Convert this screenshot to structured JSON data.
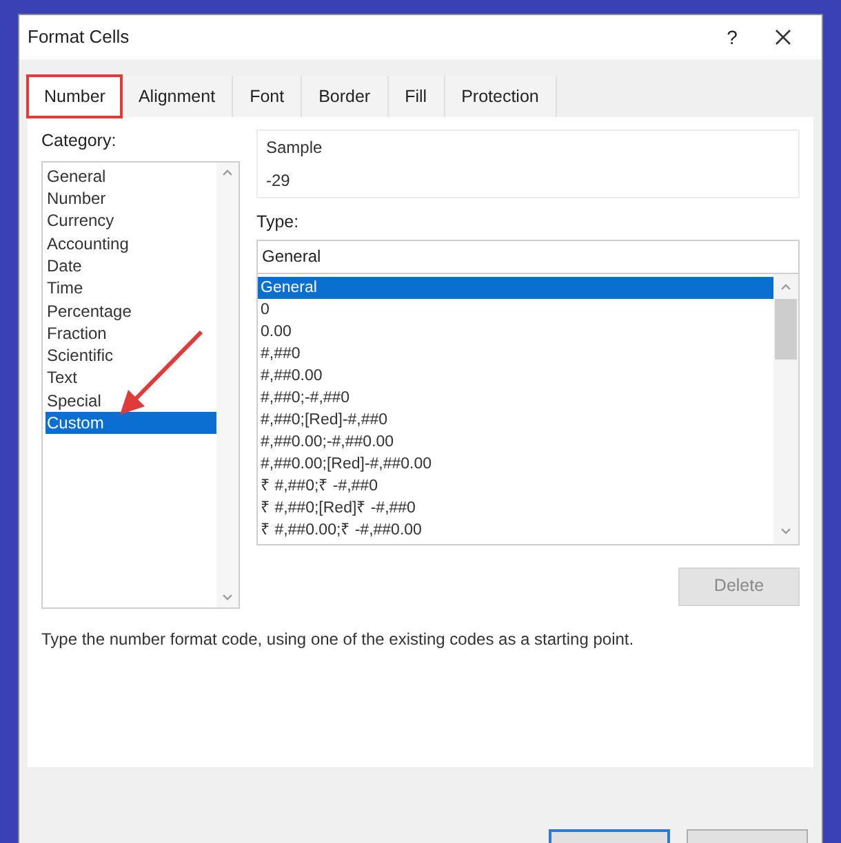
{
  "window": {
    "title": "Format Cells",
    "help": "?"
  },
  "tabs": [
    {
      "label": "Number",
      "selected": true,
      "highlighted": true
    },
    {
      "label": "Alignment",
      "selected": false,
      "highlighted": false
    },
    {
      "label": "Font",
      "selected": false,
      "highlighted": false
    },
    {
      "label": "Border",
      "selected": false,
      "highlighted": false
    },
    {
      "label": "Fill",
      "selected": false,
      "highlighted": false
    },
    {
      "label": "Protection",
      "selected": false,
      "highlighted": false
    }
  ],
  "category": {
    "label": "Category:",
    "items": [
      {
        "label": "General",
        "selected": false
      },
      {
        "label": "Number",
        "selected": false
      },
      {
        "label": "Currency",
        "selected": false
      },
      {
        "label": "Accounting",
        "selected": false
      },
      {
        "label": "Date",
        "selected": false
      },
      {
        "label": "Time",
        "selected": false
      },
      {
        "label": "Percentage",
        "selected": false
      },
      {
        "label": "Fraction",
        "selected": false
      },
      {
        "label": "Scientific",
        "selected": false
      },
      {
        "label": "Text",
        "selected": false
      },
      {
        "label": "Special",
        "selected": false
      },
      {
        "label": "Custom",
        "selected": true,
        "arrow": true
      }
    ]
  },
  "sample": {
    "label": "Sample",
    "value": "-29"
  },
  "type": {
    "label": "Type:",
    "value": "General",
    "items": [
      {
        "label": "General",
        "selected": true
      },
      {
        "label": "0",
        "selected": false
      },
      {
        "label": "0.00",
        "selected": false
      },
      {
        "label": "#,##0",
        "selected": false
      },
      {
        "label": "#,##0.00",
        "selected": false
      },
      {
        "label": "#,##0;-#,##0",
        "selected": false
      },
      {
        "label": "#,##0;[Red]-#,##0",
        "selected": false
      },
      {
        "label": "#,##0.00;-#,##0.00",
        "selected": false
      },
      {
        "label": "#,##0.00;[Red]-#,##0.00",
        "selected": false
      },
      {
        "label": "₹ #,##0;₹ -#,##0",
        "selected": false
      },
      {
        "label": "₹ #,##0;[Red]₹ -#,##0",
        "selected": false
      },
      {
        "label": "₹ #,##0.00;₹ -#,##0.00",
        "selected": false
      }
    ]
  },
  "delete_button": {
    "label": "Delete",
    "disabled": true
  },
  "description": "Type the number format code, using one of the existing codes as a starting point.",
  "footer_buttons": [
    {
      "kind": "default"
    },
    {
      "kind": "normal"
    }
  ]
}
